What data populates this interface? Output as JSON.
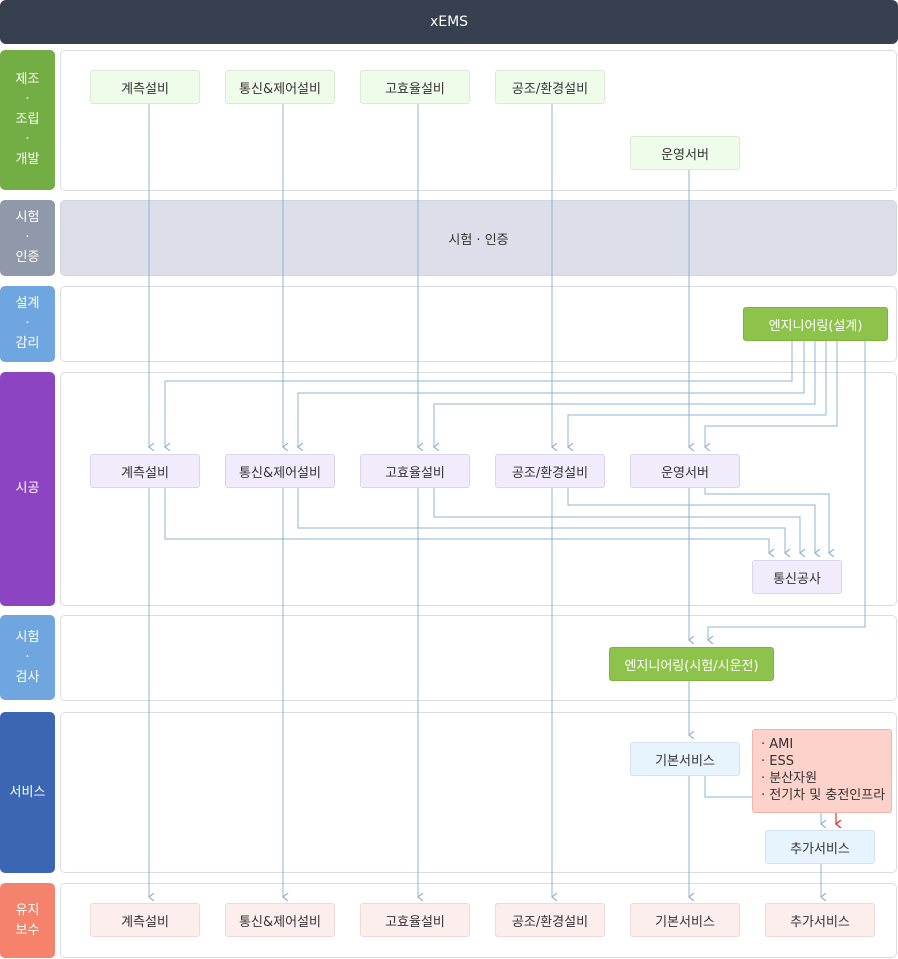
{
  "title": "xEMS",
  "colors": {
    "header": "#36404f",
    "stage_manufacture": "#72ae44",
    "stage_test_cert": "#9099aa",
    "stage_design": "#6fa6e0",
    "stage_construction": "#8d44c3",
    "stage_test_inspect": "#6fa6e0",
    "stage_service": "#3a66b4",
    "stage_maintenance": "#f5826a",
    "arrow": "#8eb4d5",
    "arrow_red": "#e0342b"
  },
  "stages": [
    {
      "label": "제조\n·\n조립\n·\n개발"
    },
    {
      "label": "시험\n·\n인증"
    },
    {
      "label": "설계\n·\n감리"
    },
    {
      "label": "시공"
    },
    {
      "label": "시험\n·\n검사"
    },
    {
      "label": "서비스"
    },
    {
      "label": "유지\n보수"
    }
  ],
  "manufacture": {
    "items": [
      "계측설비",
      "통신&제어설비",
      "고효율설비",
      "공조/환경설비",
      "운영서버"
    ]
  },
  "test_cert": {
    "label": "시험 · 인증"
  },
  "design": {
    "engineering": "엔지니어링(설계)"
  },
  "construction": {
    "items": [
      "계측설비",
      "통신&제어설비",
      "고효율설비",
      "공조/환경설비",
      "운영서버"
    ],
    "comm_work": "통신공사"
  },
  "inspection": {
    "engineering": "엔지니어링(시험/시운전)"
  },
  "service": {
    "basic": "기본서비스",
    "additional": "추가서비스",
    "list": [
      "· AMI",
      "· ESS",
      "· 분산자원",
      "· 전기차 및 충전인프라"
    ]
  },
  "maintenance": {
    "items": [
      "계측설비",
      "통신&제어설비",
      "고효율설비",
      "공조/환경설비",
      "기본서비스",
      "추가서비스"
    ]
  }
}
